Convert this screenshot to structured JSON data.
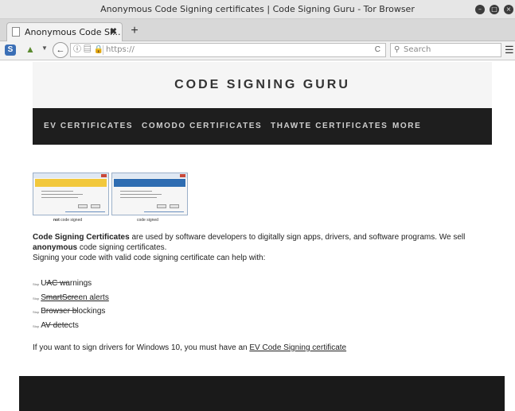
{
  "window": {
    "title": "Anonymous Code Signing certificates | Code Signing Guru - Tor Browser",
    "controls": [
      "minimize-icon",
      "maximize-icon",
      "close-icon"
    ]
  },
  "tabs": [
    {
      "label": "Anonymous Code Si...",
      "close": "✖"
    }
  ],
  "new_tab_label": "+",
  "navbar": {
    "url": "https://",
    "reload": "C",
    "search_placeholder": "Search",
    "icons": [
      "noscript-icon",
      "onion-icon",
      "back-icon",
      "info-icon",
      "lock-icon",
      "reload-icon",
      "search-icon",
      "hamburger-menu-icon"
    ]
  },
  "site": {
    "title": "CODE SIGNING GURU",
    "nav": [
      "EV CERTIFICATES",
      "COMODO CERTIFICATES",
      "THAWTE CERTIFICATES",
      "MORE"
    ]
  },
  "images": {
    "left_caption_bold": "not",
    "left_caption_rest": " code signed",
    "right_caption": "code signed"
  },
  "intro": {
    "p1_bold1": "Code Signing Certificates",
    "p1_text1": " are used by software developers to digitally sign apps, drivers, and software programs. We sell ",
    "p1_bold2": "anonymous",
    "p1_text2": " code signing certificates.",
    "p2": "Signing your code with valid code signing certificate can help with:"
  },
  "benefits": [
    {
      "tiny": "Stop",
      "label": "UAC warnings",
      "link": false
    },
    {
      "tiny": "Stop",
      "label": "SmartScreen alerts",
      "link": true
    },
    {
      "tiny": "Stop",
      "label": "Browser blockings",
      "link": false
    },
    {
      "tiny": "Stop",
      "label": "AV detects",
      "link": false
    }
  ],
  "drivers": {
    "text": "If you want to sign drivers for Windows 10, you must have an ",
    "link": "EV Code Signing certificate"
  },
  "colors": {
    "nav_bg": "#1e1e1e",
    "header_bg": "#f5f5f5",
    "footer_bg": "#1a1a1a",
    "uac_yellow": "#f2c83c",
    "uac_blue": "#2f6db2"
  }
}
